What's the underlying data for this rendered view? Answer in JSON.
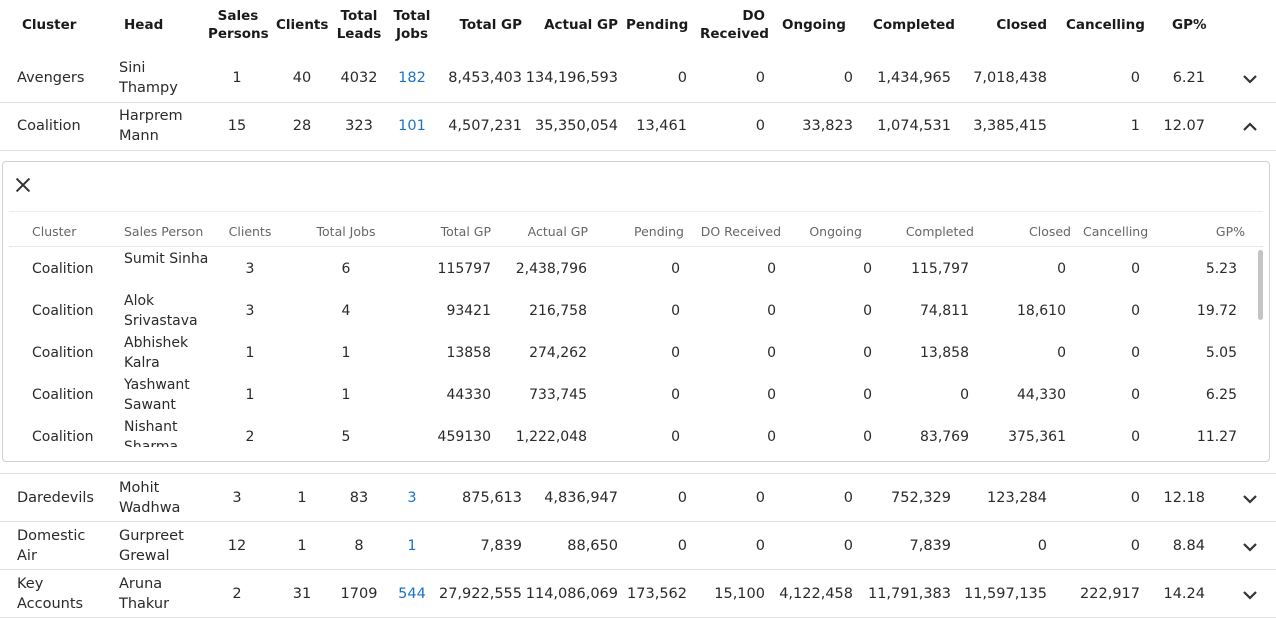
{
  "headers": {
    "cluster": "Cluster",
    "head": "Head",
    "sales_persons": "Sales Persons",
    "clients": "Clients",
    "total_leads": "Total Leads",
    "total_jobs": "Total Jobs",
    "total_gp": "Total GP",
    "actual_gp": "Actual GP",
    "pending": "Pending",
    "do_received": "DO Received",
    "ongoing": "Ongoing",
    "completed": "Completed",
    "closed": "Closed",
    "cancelling": "Cancelling",
    "gp_pct": "GP%"
  },
  "rows": [
    {
      "cluster": "Avengers",
      "head": "Sini Thampy",
      "sales_persons": "1",
      "clients": "40",
      "total_leads": "4032",
      "total_jobs": "182",
      "total_gp": "8,453,403",
      "actual_gp": "134,196,593",
      "pending": "0",
      "do_received": "0",
      "ongoing": "0",
      "completed": "1,434,965",
      "closed": "7,018,438",
      "cancelling": "0",
      "gp_pct": "6.21",
      "expanded": false
    },
    {
      "cluster": "Coalition",
      "head": "Harprem Mann",
      "sales_persons": "15",
      "clients": "28",
      "total_leads": "323",
      "total_jobs": "101",
      "total_gp": "4,507,231",
      "actual_gp": "35,350,054",
      "pending": "13,461",
      "do_received": "0",
      "ongoing": "33,823",
      "completed": "1,074,531",
      "closed": "3,385,415",
      "cancelling": "1",
      "gp_pct": "12.07",
      "expanded": true
    },
    {
      "cluster": "Daredevils",
      "head": "Mohit Wadhwa",
      "sales_persons": "3",
      "clients": "1",
      "total_leads": "83",
      "total_jobs": "3",
      "total_gp": "875,613",
      "actual_gp": "4,836,947",
      "pending": "0",
      "do_received": "0",
      "ongoing": "0",
      "completed": "752,329",
      "closed": "123,284",
      "cancelling": "0",
      "gp_pct": "12.18",
      "expanded": false
    },
    {
      "cluster": "Domestic Air",
      "head": "Gurpreet Grewal",
      "sales_persons": "12",
      "clients": "1",
      "total_leads": "8",
      "total_jobs": "1",
      "total_gp": "7,839",
      "actual_gp": "88,650",
      "pending": "0",
      "do_received": "0",
      "ongoing": "0",
      "completed": "7,839",
      "closed": "0",
      "cancelling": "0",
      "gp_pct": "8.84",
      "expanded": false
    },
    {
      "cluster": "Key Accounts",
      "head": "Aruna Thakur",
      "sales_persons": "2",
      "clients": "31",
      "total_leads": "1709",
      "total_jobs": "544",
      "total_gp": "27,922,555",
      "actual_gp": "114,086,069",
      "pending": "173,562",
      "do_received": "15,100",
      "ongoing": "4,122,458",
      "completed": "11,791,383",
      "closed": "11,597,135",
      "cancelling": "222,917",
      "gp_pct": "14.24",
      "expanded": false
    }
  ],
  "detail": {
    "headers": {
      "cluster": "Cluster",
      "sales_person": "Sales Person",
      "clients": "Clients",
      "total_jobs": "Total Jobs",
      "total_gp": "Total GP",
      "actual_gp": "Actual GP",
      "pending": "Pending",
      "do_received": "DO Received",
      "ongoing": "Ongoing",
      "completed": "Completed",
      "closed": "Closed",
      "cancelling": "Cancelling",
      "gp_pct": "GP%"
    },
    "rows": [
      {
        "cluster": "Coalition",
        "sales_person": "Sumit Sinha",
        "clients": "3",
        "total_jobs": "6",
        "total_gp": "115797",
        "actual_gp": "2,438,796",
        "pending": "0",
        "do_received": "0",
        "ongoing": "0",
        "completed": "115,797",
        "closed": "0",
        "cancelling": "0",
        "gp_pct": "5.23"
      },
      {
        "cluster": "Coalition",
        "sales_person": "Alok Srivastava",
        "clients": "3",
        "total_jobs": "4",
        "total_gp": "93421",
        "actual_gp": "216,758",
        "pending": "0",
        "do_received": "0",
        "ongoing": "0",
        "completed": "74,811",
        "closed": "18,610",
        "cancelling": "0",
        "gp_pct": "19.72"
      },
      {
        "cluster": "Coalition",
        "sales_person": "Abhishek Kalra",
        "clients": "1",
        "total_jobs": "1",
        "total_gp": "13858",
        "actual_gp": "274,262",
        "pending": "0",
        "do_received": "0",
        "ongoing": "0",
        "completed": "13,858",
        "closed": "0",
        "cancelling": "0",
        "gp_pct": "5.05"
      },
      {
        "cluster": "Coalition",
        "sales_person": "Yashwant Sawant",
        "clients": "1",
        "total_jobs": "1",
        "total_gp": "44330",
        "actual_gp": "733,745",
        "pending": "0",
        "do_received": "0",
        "ongoing": "0",
        "completed": "0",
        "closed": "44,330",
        "cancelling": "0",
        "gp_pct": "6.25"
      },
      {
        "cluster": "Coalition",
        "sales_person": "Nishant Sharma",
        "clients": "2",
        "total_jobs": "5",
        "total_gp": "459130",
        "actual_gp": "1,222,048",
        "pending": "0",
        "do_received": "0",
        "ongoing": "0",
        "completed": "83,769",
        "closed": "375,361",
        "cancelling": "0",
        "gp_pct": "11.27"
      }
    ]
  },
  "colors": {
    "link": "#1a73c8",
    "border": "#d0d0d0",
    "divider": "#e3e3e3"
  },
  "icons": {
    "expand": "chevron-down-icon",
    "collapse": "chevron-up-icon",
    "close": "close-icon"
  }
}
